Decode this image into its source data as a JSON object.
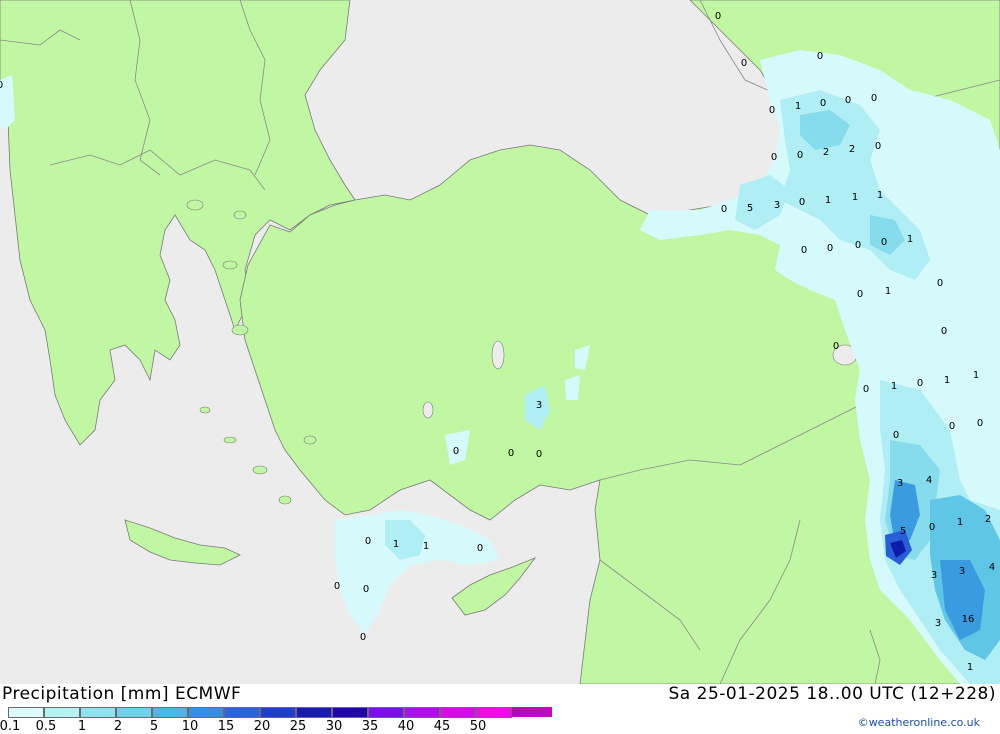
{
  "map": {
    "colors": {
      "sea": "#ececec",
      "land": "#c1f7a2",
      "border": "#8a8a8a",
      "coast": "#7a7a7a",
      "precip_1": "#d6fafb",
      "precip_2": "#b0eef5",
      "precip_3": "#86dcec",
      "precip_4": "#5fc6e6",
      "precip_5": "#3a9be0",
      "precip_6": "#2a5ed8",
      "precip_7": "#0d1faa"
    },
    "labels": [
      "0",
      "0",
      "0",
      "1",
      "0",
      "0",
      "0",
      "0",
      "0",
      "2",
      "2",
      "0",
      "0",
      "5",
      "3",
      "0",
      "1",
      "1",
      "1",
      "1",
      "0",
      "0",
      "0",
      "0",
      "0",
      "0",
      "0",
      "1",
      "0",
      "0",
      "0",
      "1",
      "0",
      "1",
      "1",
      "0",
      "0",
      "3",
      "4",
      "5",
      "0",
      "1",
      "2",
      "3",
      "3",
      "4",
      "3",
      "16",
      "1",
      "3",
      "0",
      "0",
      "0",
      "0",
      "0",
      "0",
      "1",
      "1",
      "0",
      "0",
      "0",
      "0"
    ]
  },
  "footer": {
    "title": "Precipitation [mm] ECMWF",
    "datetime": "Sa 25-01-2025 18..00 UTC (12+228)",
    "credit": "©weatheronline.co.uk"
  },
  "legend": {
    "colors": [
      "#dcfcfc",
      "#b4f2f4",
      "#8fe3ee",
      "#6ed0ea",
      "#50b4e4",
      "#3a8ede",
      "#2c66d6",
      "#2040c4",
      "#1a1ea6",
      "#2008a0",
      "#7d10e6",
      "#a812e6",
      "#d40ee0",
      "#f00ce0",
      "#c40ac0"
    ],
    "arrow_color": "#b00cb8",
    "ticks": [
      "0.1",
      "0.5",
      "1",
      "2",
      "5",
      "10",
      "15",
      "20",
      "25",
      "30",
      "35",
      "40",
      "45",
      "50"
    ]
  }
}
